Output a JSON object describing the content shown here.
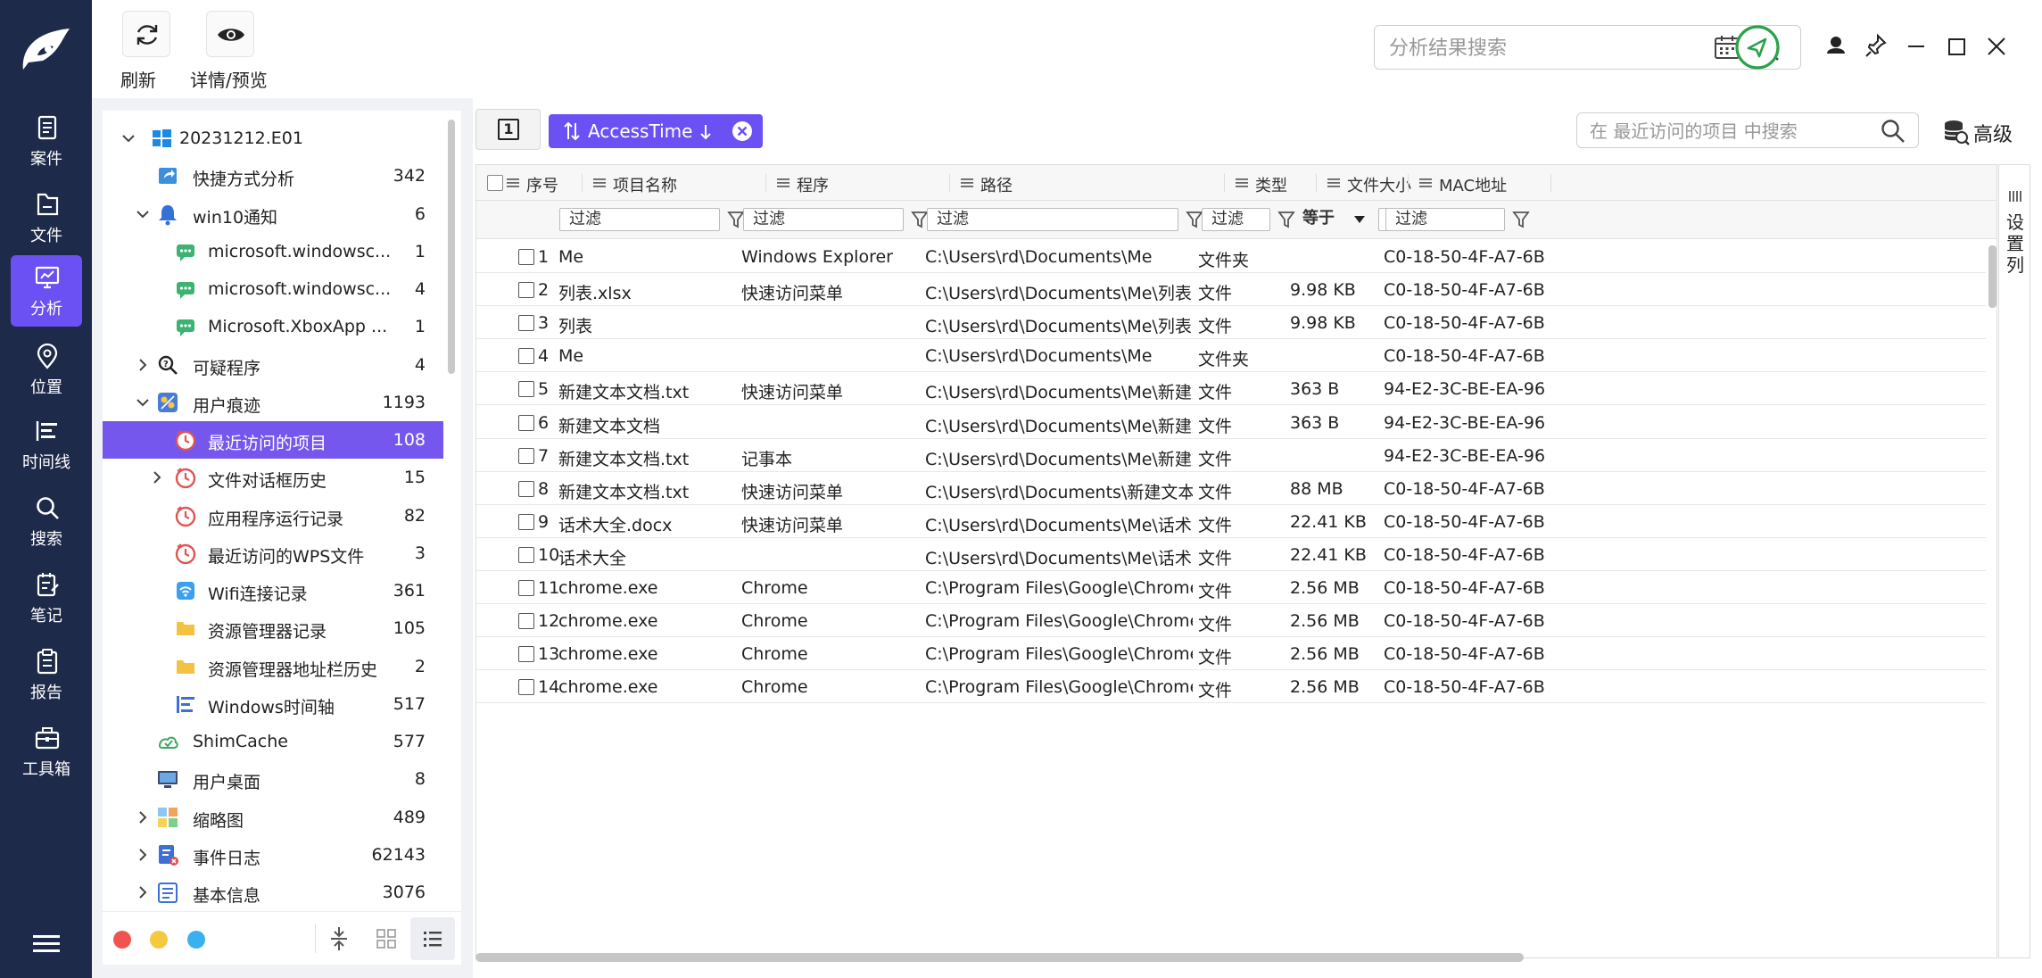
{
  "nav": {
    "items": [
      {
        "label": "案件",
        "icon": "case-icon"
      },
      {
        "label": "文件",
        "icon": "file-icon"
      },
      {
        "label": "分析",
        "icon": "analysis-icon"
      },
      {
        "label": "位置",
        "icon": "location-icon"
      },
      {
        "label": "时间线",
        "icon": "timeline-icon"
      },
      {
        "label": "搜索",
        "icon": "search-icon"
      },
      {
        "label": "笔记",
        "icon": "notes-icon"
      },
      {
        "label": "报告",
        "icon": "report-icon"
      },
      {
        "label": "工具箱",
        "icon": "toolbox-icon"
      }
    ],
    "active_index": 2
  },
  "toolbar": {
    "refresh_label": "刷新",
    "preview_label": "详情/预览",
    "search_placeholder": "分析结果搜索"
  },
  "tree": {
    "root_label": "20231212.E01",
    "items": [
      {
        "label": "快捷方式分析",
        "count": "342"
      },
      {
        "label": "win10通知",
        "count": "6"
      },
      {
        "label": "microsoft.windowsc...",
        "count": "1"
      },
      {
        "label": "microsoft.windowsc...",
        "count": "4"
      },
      {
        "label": "Microsoft.XboxApp ...",
        "count": "1"
      },
      {
        "label": "可疑程序",
        "count": "4"
      },
      {
        "label": "用户痕迹",
        "count": "1193"
      },
      {
        "label": "最近访问的项目",
        "count": "108"
      },
      {
        "label": "文件对话框历史",
        "count": "15"
      },
      {
        "label": "应用程序运行记录",
        "count": "82"
      },
      {
        "label": "最近访问的WPS文件",
        "count": "3"
      },
      {
        "label": "Wifi连接记录",
        "count": "361"
      },
      {
        "label": "资源管理器记录",
        "count": "105"
      },
      {
        "label": "资源管理器地址栏历史",
        "count": "2"
      },
      {
        "label": "Windows时间轴",
        "count": "517"
      },
      {
        "label": "ShimCache",
        "count": "577"
      },
      {
        "label": "用户桌面",
        "count": "8"
      },
      {
        "label": "缩略图",
        "count": "489"
      },
      {
        "label": "事件日志",
        "count": "62143"
      },
      {
        "label": "基本信息",
        "count": "3076"
      }
    ]
  },
  "main": {
    "page_number": "1",
    "sort_chip_label": "AccessTime",
    "table_search_placeholder": "在 最近访问的项目 中搜索",
    "advanced_label": "高级",
    "column_settings_label": "设置列",
    "columns": [
      "序号",
      "项目名称",
      "程序",
      "路径",
      "类型",
      "文件大小",
      "MAC地址"
    ],
    "filter_placeholder": "过滤",
    "size_filter_operator": "等于",
    "rows": [
      {
        "n": "1",
        "name": "Me",
        "prog": "Windows Explorer",
        "path": "C:\\Users\\rd\\Documents\\Me",
        "type": "文件夹",
        "size": "",
        "mac": "C0-18-50-4F-A7-6B"
      },
      {
        "n": "2",
        "name": "列表.xlsx",
        "prog": "快速访问菜单",
        "path": "C:\\Users\\rd\\Documents\\Me\\列表.xlsx",
        "type": "文件",
        "size": "9.98 KB",
        "mac": "C0-18-50-4F-A7-6B"
      },
      {
        "n": "3",
        "name": "列表",
        "prog": "",
        "path": "C:\\Users\\rd\\Documents\\Me\\列表.xlsx",
        "type": "文件",
        "size": "9.98 KB",
        "mac": "C0-18-50-4F-A7-6B"
      },
      {
        "n": "4",
        "name": "Me",
        "prog": "",
        "path": "C:\\Users\\rd\\Documents\\Me",
        "type": "文件夹",
        "size": "",
        "mac": "C0-18-50-4F-A7-6B"
      },
      {
        "n": "5",
        "name": "新建文本文档.txt",
        "prog": "快速访问菜单",
        "path": "C:\\Users\\rd\\Documents\\Me\\新建文本文档....",
        "type": "文件",
        "size": "363 B",
        "mac": "94-E2-3C-BE-EA-96"
      },
      {
        "n": "6",
        "name": "新建文本文档",
        "prog": "",
        "path": "C:\\Users\\rd\\Documents\\Me\\新建文本文档....",
        "type": "文件",
        "size": "363 B",
        "mac": "94-E2-3C-BE-EA-96"
      },
      {
        "n": "7",
        "name": "新建文本文档.txt",
        "prog": "记事本",
        "path": "C:\\Users\\rd\\Documents\\Me\\新建文本文档....",
        "type": "文件",
        "size": "",
        "mac": "94-E2-3C-BE-EA-96"
      },
      {
        "n": "8",
        "name": "新建文本文档.txt",
        "prog": "快速访问菜单",
        "path": "C:\\Users\\rd\\Documents\\新建文本文档.txt",
        "type": "文件",
        "size": "88 MB",
        "mac": "C0-18-50-4F-A7-6B"
      },
      {
        "n": "9",
        "name": "话术大全.docx",
        "prog": "快速访问菜单",
        "path": "C:\\Users\\rd\\Documents\\Me\\话术大全.docx",
        "type": "文件",
        "size": "22.41 KB",
        "mac": "C0-18-50-4F-A7-6B"
      },
      {
        "n": "10",
        "name": "话术大全",
        "prog": "",
        "path": "C:\\Users\\rd\\Documents\\Me\\话术大全.docx",
        "type": "文件",
        "size": "22.41 KB",
        "mac": "C0-18-50-4F-A7-6B"
      },
      {
        "n": "11",
        "name": "chrome.exe",
        "prog": "Chrome",
        "path": "C:\\Program Files\\Google\\Chrome\\Applicati...",
        "type": "文件",
        "size": "2.56 MB",
        "mac": "C0-18-50-4F-A7-6B"
      },
      {
        "n": "12",
        "name": "chrome.exe",
        "prog": "Chrome",
        "path": "C:\\Program Files\\Google\\Chrome\\Applicati...",
        "type": "文件",
        "size": "2.56 MB",
        "mac": "C0-18-50-4F-A7-6B"
      },
      {
        "n": "13",
        "name": "chrome.exe",
        "prog": "Chrome",
        "path": "C:\\Program Files\\Google\\Chrome\\Applicati...",
        "type": "文件",
        "size": "2.56 MB",
        "mac": "C0-18-50-4F-A7-6B"
      },
      {
        "n": "14",
        "name": "chrome.exe",
        "prog": "Chrome",
        "path": "C:\\Program Files\\Google\\Chrome\\Applicati...",
        "type": "文件",
        "size": "2.56 MB",
        "mac": "C0-18-50-4F-A7-6B"
      }
    ]
  },
  "colors": {
    "accent": "#6b51f3",
    "nav_bg": "#1e2a4a",
    "selected_row": "#7657ee"
  }
}
